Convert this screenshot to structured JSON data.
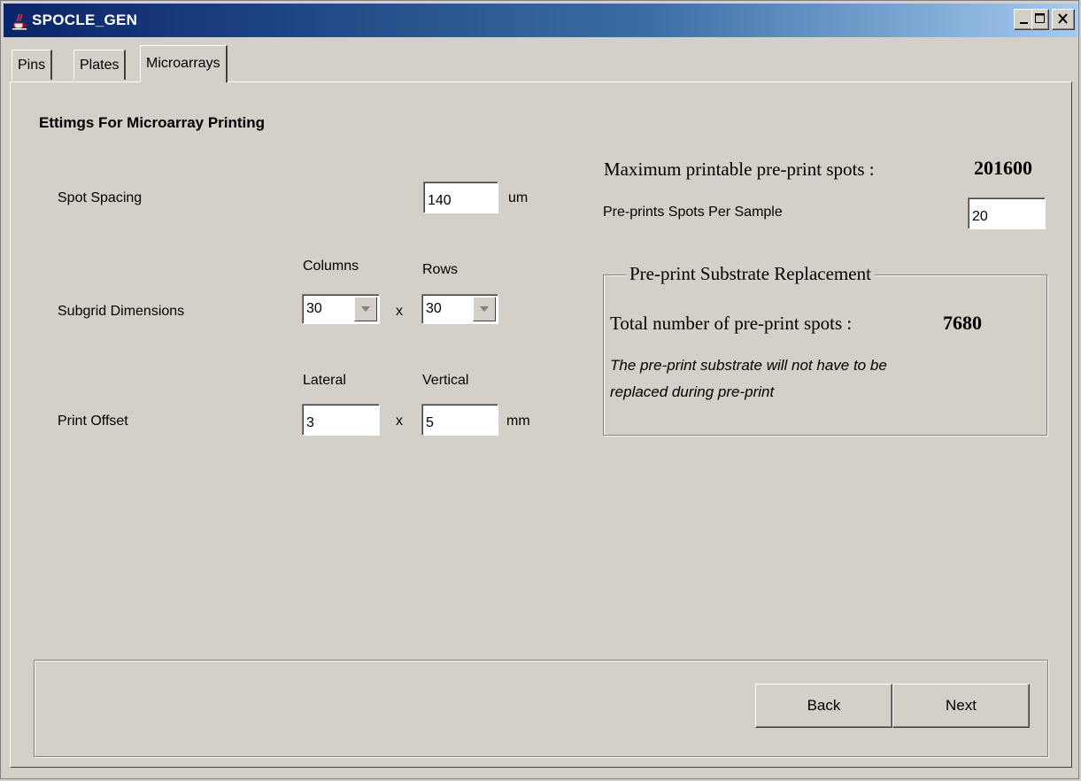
{
  "window": {
    "title": "SPOCLE_GEN"
  },
  "tabs": [
    {
      "label": "Pins"
    },
    {
      "label": "Plates"
    },
    {
      "label": "Microarrays"
    }
  ],
  "main": {
    "heading": "Ettimgs For Microarray Printing",
    "spot_spacing": {
      "label": "Spot  Spacing",
      "value": "140",
      "unit": "um"
    },
    "subgrid": {
      "label": "Subgrid Dimensions",
      "columns_label": "Columns",
      "rows_label": "Rows",
      "columns_value": "30",
      "rows_value": "30",
      "sep": "x"
    },
    "print_offset": {
      "label": "Print Offset",
      "lateral_label": "Lateral",
      "vertical_label": "Vertical",
      "lateral_value": "3",
      "vertical_value": "5",
      "sep": "x",
      "unit": "mm"
    }
  },
  "right": {
    "max_label": "Maximum printable pre-print spots :",
    "max_value": "201600",
    "per_sample_label": "Pre-prints Spots Per Sample",
    "per_sample_value": "20",
    "group": {
      "title": "Pre-print Substrate Replacement",
      "total_label": "Total number of pre-print spots :",
      "total_value": "7680",
      "message_line1": "The pre-print substrate will not have to be",
      "message_line2": "replaced during pre-print"
    }
  },
  "footer": {
    "back_label": "Back",
    "next_label": "Next"
  }
}
